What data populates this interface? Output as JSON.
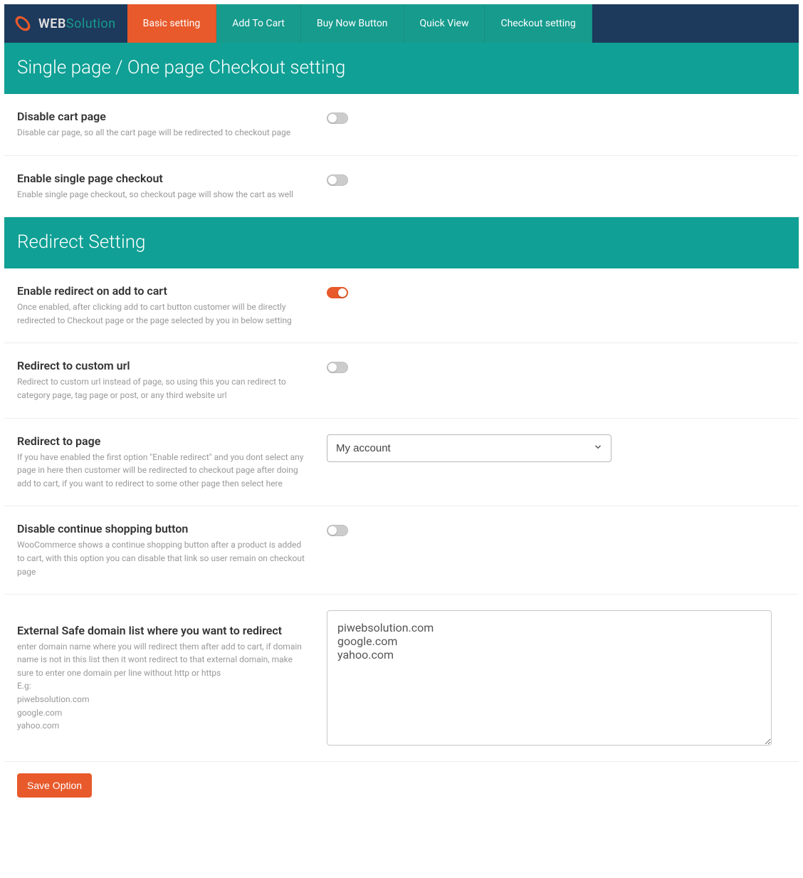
{
  "logo": {
    "web": "WEB",
    "solution": "Solution"
  },
  "tabs": [
    {
      "label": "Basic setting",
      "active": true
    },
    {
      "label": "Add To Cart",
      "active": false
    },
    {
      "label": "Buy Now Button",
      "active": false
    },
    {
      "label": "Quick View",
      "active": false
    },
    {
      "label": "Checkout setting",
      "active": false
    }
  ],
  "sections": {
    "single_page": {
      "title": "Single page / One page Checkout setting"
    },
    "redirect": {
      "title": "Redirect Setting"
    }
  },
  "settings": {
    "disable_cart": {
      "title": "Disable cart page",
      "desc": "Disable car page, so all the cart page will be redirected to checkout page",
      "on": false
    },
    "enable_single": {
      "title": "Enable single page checkout",
      "desc": "Enable single page checkout, so checkout page will show the cart as well",
      "on": false
    },
    "enable_redirect": {
      "title": "Enable redirect on add to cart",
      "desc": "Once enabled, after clicking add to cart button customer will be directly redirected to Checkout page or the page selected by you in below setting",
      "on": true
    },
    "redirect_custom": {
      "title": "Redirect to custom url",
      "desc": "Redirect to custom url instead of page, so using this you can redirect to category page, tag page or post, or any third website url",
      "on": false
    },
    "redirect_page": {
      "title": "Redirect to page",
      "desc": "If you have enabled the first option \"Enable redirect\" and you dont select any page in here then customer will be redirected to checkout page after doing add to cart, if you want to redirect to some other page then select here",
      "selected": "My account"
    },
    "disable_continue": {
      "title": "Disable continue shopping button",
      "desc": "WooCommerce shows a continue shopping button after a product is added to cart, with this option you can disable that link so user remain on checkout page",
      "on": false
    },
    "safe_domains": {
      "title": "External Safe domain list where you want to redirect",
      "desc": "enter domain name where you will redirect them after add to cart, if domain name is not in this list then it wont redirect to that external domain, make sure to enter one domain per line without http or https\nE.g:\npiwebsolution.com\ngoogle.com\nyahoo.com",
      "value": "piwebsolution.com\ngoogle.com\nyahoo.com"
    }
  },
  "buttons": {
    "save": "Save Option"
  }
}
